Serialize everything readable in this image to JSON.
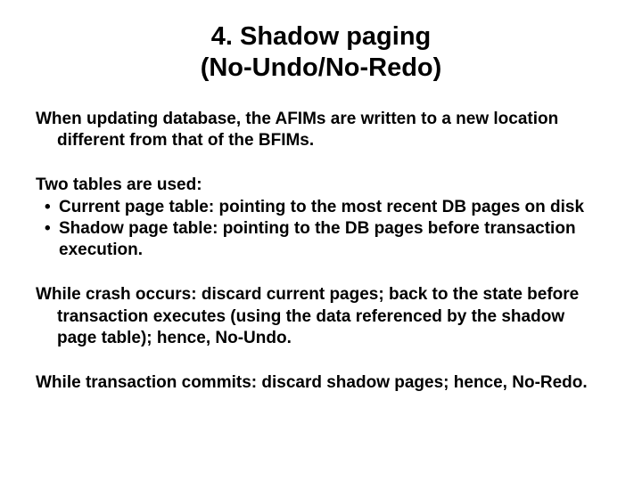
{
  "title_line1": "4. Shadow paging",
  "title_line2": "(No-Undo/No-Redo)",
  "p1_line1": "When updating database, the AFIMs are written to a new location",
  "p1_line2": "different from that of the BFIMs.",
  "tables_lead": "Two tables are used:",
  "bullet1": "Current page table: pointing to the most recent DB pages on disk",
  "bullet2_line1": "Shadow page table: pointing to the DB pages before transaction",
  "bullet2_line2": "execution.",
  "p2_line1": "While crash occurs: discard current pages; back to the state before",
  "p2_line2": "transaction executes (using the data referenced by the shadow",
  "p2_line3": "page table); hence, No-Undo.",
  "p3": "While transaction commits: discard shadow pages; hence, No-Redo."
}
